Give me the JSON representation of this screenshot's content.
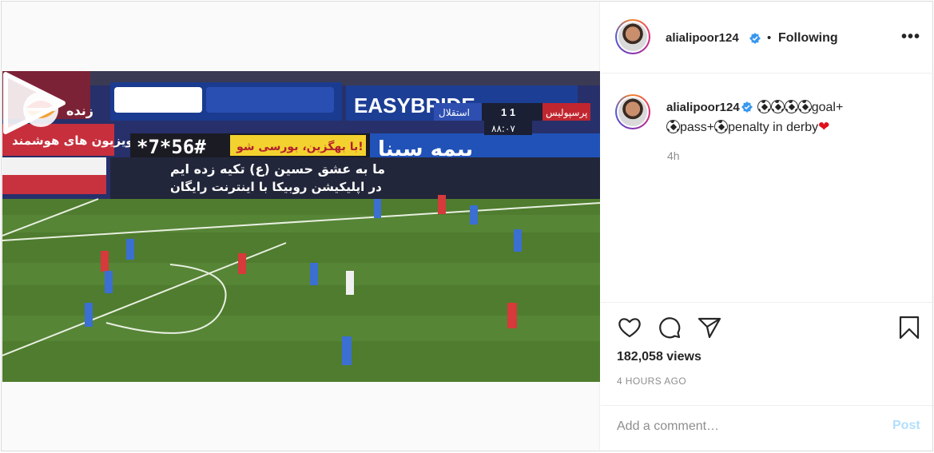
{
  "post": {
    "username": "alialipoor124",
    "follow_status": "Following",
    "separator": "•",
    "more_icon": "more-horizontal-icon"
  },
  "caption": {
    "username": "alialipoor124",
    "part1": "goal+",
    "part2": "pass+",
    "part3": "penalty in derby",
    "emoji": "❤",
    "time": "4h"
  },
  "stats": {
    "views": "182,058 views",
    "posted_ago": "4 HOURS AGO"
  },
  "comment_box": {
    "placeholder": "Add a comment…",
    "post_label": "Post"
  },
  "video_overlay": {
    "channel_label": "زنده",
    "team_home": "پرسپولیس",
    "team_away": "استقلال",
    "score": "1  1",
    "clock": "۸۸:۰۷",
    "sponsor_en": "EASYBRIDE",
    "code_text": "*7*56#",
    "banner_fa": "با بهگزین، بورسی شو!",
    "slogan_line1": "ما به عشق حسین (ع) تکیه زده ایم",
    "slogan_line2": "در اپلیکیشن روبیکا با اینترنت رایگان",
    "sponsor_fa": "بیمه سینا",
    "side_banner": "تلویزیون های هوشمند"
  },
  "colors": {
    "pitch": "#4f7c2e",
    "link_blue": "#0095f6",
    "post_disabled": "#b2dffc",
    "heart_red": "#e0101d"
  }
}
